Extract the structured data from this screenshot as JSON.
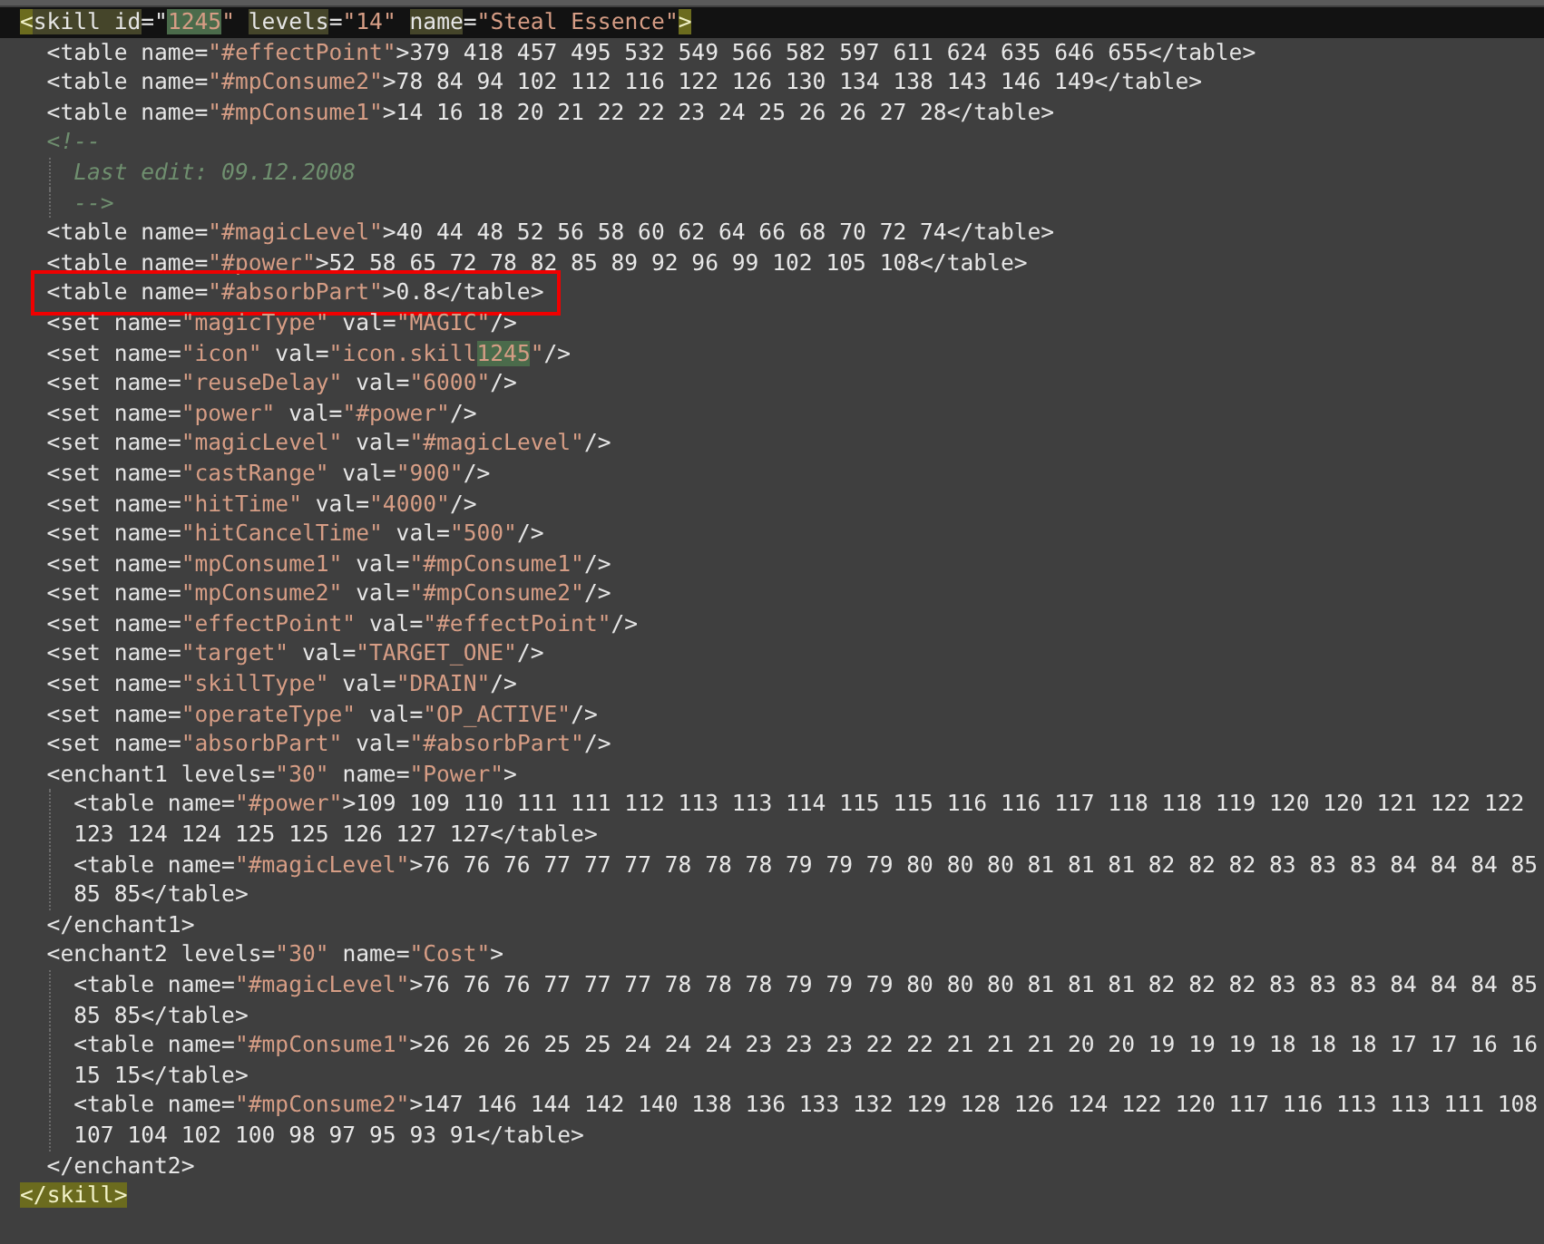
{
  "editor": {
    "lines": [
      {
        "current": true,
        "tokens": [
          {
            "text": "<",
            "kind": "bracket"
          },
          {
            "text": "skill",
            "kind": "word"
          },
          {
            "text": " id",
            "kind": "word"
          },
          {
            "text": "=\"",
            "kind": "attr"
          },
          {
            "text": "1245",
            "kind": "match"
          },
          {
            "text": "\" ",
            "kind": "value"
          },
          {
            "text": "levels",
            "kind": "word"
          },
          {
            "text": "=",
            "kind": "attr"
          },
          {
            "text": "\"14\" ",
            "kind": "value"
          },
          {
            "text": "name",
            "kind": "word"
          },
          {
            "text": "=",
            "kind": "attr"
          },
          {
            "text": "\"Steal Essence\"",
            "kind": "value"
          },
          {
            "text": ">",
            "kind": "bracket"
          }
        ],
        "children": [
          {
            "tokens": [
              {
                "text": "<table",
                "kind": "tag"
              },
              {
                "text": " name=",
                "kind": "attr"
              },
              {
                "text": "\"#effectPoint\"",
                "kind": "value"
              },
              {
                "text": ">",
                "kind": "tag"
              },
              {
                "text": "379 418 457 495 532 549 566 582 597 611 624 635 646 655",
                "kind": "text"
              },
              {
                "text": "</table>",
                "kind": "tag"
              }
            ]
          },
          {
            "tokens": [
              {
                "text": "<table",
                "kind": "tag"
              },
              {
                "text": " name=",
                "kind": "attr"
              },
              {
                "text": "\"#mpConsume2\"",
                "kind": "value"
              },
              {
                "text": ">",
                "kind": "tag"
              },
              {
                "text": "78 84 94 102 112 116 122 126 130 134 138 143 146 149",
                "kind": "text"
              },
              {
                "text": "</table>",
                "kind": "tag"
              }
            ]
          },
          {
            "tokens": [
              {
                "text": "<table",
                "kind": "tag"
              },
              {
                "text": " name=",
                "kind": "attr"
              },
              {
                "text": "\"#mpConsume1\"",
                "kind": "value"
              },
              {
                "text": ">",
                "kind": "tag"
              },
              {
                "text": "14 16 18 20 21 22 22 23 24 25 26 26 27 28",
                "kind": "text"
              },
              {
                "text": "</table>",
                "kind": "tag"
              }
            ]
          },
          {
            "guides": true,
            "tokens": [
              {
                "text": "<!--",
                "kind": "comment"
              }
            ],
            "children": [
              {
                "tokens": [
                  {
                    "text": "Last edit: 09.12.2008",
                    "kind": "comment"
                  }
                ]
              },
              {
                "tokens": [
                  {
                    "text": "-->",
                    "kind": "comment"
                  }
                ]
              }
            ]
          },
          {
            "tokens": [
              {
                "text": "<table",
                "kind": "tag"
              },
              {
                "text": " name=",
                "kind": "attr"
              },
              {
                "text": "\"#magicLevel\"",
                "kind": "value"
              },
              {
                "text": ">",
                "kind": "tag"
              },
              {
                "text": "40 44 48 52 56 58 60 62 64 66 68 70 72 74",
                "kind": "text"
              },
              {
                "text": "</table>",
                "kind": "tag"
              }
            ]
          },
          {
            "tokens": [
              {
                "text": "<table",
                "kind": "tag"
              },
              {
                "text": " name=",
                "kind": "attr"
              },
              {
                "text": "\"#power\"",
                "kind": "value"
              },
              {
                "text": ">",
                "kind": "tag"
              },
              {
                "text": "52 58 65 72 78 82 85 89 92 96 99 102 105 108",
                "kind": "text"
              },
              {
                "text": "</table>",
                "kind": "tag"
              }
            ]
          },
          {
            "boxed": true,
            "tokens": [
              {
                "text": "<table",
                "kind": "tag"
              },
              {
                "text": " name=",
                "kind": "attr"
              },
              {
                "text": "\"#absorbPart\"",
                "kind": "value"
              },
              {
                "text": ">",
                "kind": "tag"
              },
              {
                "text": "0.8",
                "kind": "text"
              },
              {
                "text": "</table>",
                "kind": "tag"
              }
            ]
          },
          {
            "tokens": [
              {
                "text": "<set",
                "kind": "tag"
              },
              {
                "text": " name=",
                "kind": "attr"
              },
              {
                "text": "\"magicType\"",
                "kind": "value"
              },
              {
                "text": " val=",
                "kind": "attr"
              },
              {
                "text": "\"MAGIC\"",
                "kind": "value"
              },
              {
                "text": "/>",
                "kind": "tag"
              }
            ]
          },
          {
            "tokens": [
              {
                "text": "<set",
                "kind": "tag"
              },
              {
                "text": " name=",
                "kind": "attr"
              },
              {
                "text": "\"icon\"",
                "kind": "value"
              },
              {
                "text": " val=",
                "kind": "attr"
              },
              {
                "text": "\"icon.skill",
                "kind": "value"
              },
              {
                "text": "1245",
                "kind": "match"
              },
              {
                "text": "\"",
                "kind": "value"
              },
              {
                "text": "/>",
                "kind": "tag"
              }
            ]
          },
          {
            "tokens": [
              {
                "text": "<set",
                "kind": "tag"
              },
              {
                "text": " name=",
                "kind": "attr"
              },
              {
                "text": "\"reuseDelay\"",
                "kind": "value"
              },
              {
                "text": " val=",
                "kind": "attr"
              },
              {
                "text": "\"6000\"",
                "kind": "value"
              },
              {
                "text": "/>",
                "kind": "tag"
              }
            ]
          },
          {
            "tokens": [
              {
                "text": "<set",
                "kind": "tag"
              },
              {
                "text": " name=",
                "kind": "attr"
              },
              {
                "text": "\"power\"",
                "kind": "value"
              },
              {
                "text": " val=",
                "kind": "attr"
              },
              {
                "text": "\"#power\"",
                "kind": "value"
              },
              {
                "text": "/>",
                "kind": "tag"
              }
            ]
          },
          {
            "tokens": [
              {
                "text": "<set",
                "kind": "tag"
              },
              {
                "text": " name=",
                "kind": "attr"
              },
              {
                "text": "\"magicLevel\"",
                "kind": "value"
              },
              {
                "text": " val=",
                "kind": "attr"
              },
              {
                "text": "\"#magicLevel\"",
                "kind": "value"
              },
              {
                "text": "/>",
                "kind": "tag"
              }
            ]
          },
          {
            "tokens": [
              {
                "text": "<set",
                "kind": "tag"
              },
              {
                "text": " name=",
                "kind": "attr"
              },
              {
                "text": "\"castRange\"",
                "kind": "value"
              },
              {
                "text": " val=",
                "kind": "attr"
              },
              {
                "text": "\"900\"",
                "kind": "value"
              },
              {
                "text": "/>",
                "kind": "tag"
              }
            ]
          },
          {
            "tokens": [
              {
                "text": "<set",
                "kind": "tag"
              },
              {
                "text": " name=",
                "kind": "attr"
              },
              {
                "text": "\"hitTime\"",
                "kind": "value"
              },
              {
                "text": " val=",
                "kind": "attr"
              },
              {
                "text": "\"4000\"",
                "kind": "value"
              },
              {
                "text": "/>",
                "kind": "tag"
              }
            ]
          },
          {
            "tokens": [
              {
                "text": "<set",
                "kind": "tag"
              },
              {
                "text": " name=",
                "kind": "attr"
              },
              {
                "text": "\"hitCancelTime\"",
                "kind": "value"
              },
              {
                "text": " val=",
                "kind": "attr"
              },
              {
                "text": "\"500\"",
                "kind": "value"
              },
              {
                "text": "/>",
                "kind": "tag"
              }
            ]
          },
          {
            "tokens": [
              {
                "text": "<set",
                "kind": "tag"
              },
              {
                "text": " name=",
                "kind": "attr"
              },
              {
                "text": "\"mpConsume1\"",
                "kind": "value"
              },
              {
                "text": " val=",
                "kind": "attr"
              },
              {
                "text": "\"#mpConsume1\"",
                "kind": "value"
              },
              {
                "text": "/>",
                "kind": "tag"
              }
            ]
          },
          {
            "tokens": [
              {
                "text": "<set",
                "kind": "tag"
              },
              {
                "text": " name=",
                "kind": "attr"
              },
              {
                "text": "\"mpConsume2\"",
                "kind": "value"
              },
              {
                "text": " val=",
                "kind": "attr"
              },
              {
                "text": "\"#mpConsume2\"",
                "kind": "value"
              },
              {
                "text": "/>",
                "kind": "tag"
              }
            ]
          },
          {
            "tokens": [
              {
                "text": "<set",
                "kind": "tag"
              },
              {
                "text": " name=",
                "kind": "attr"
              },
              {
                "text": "\"effectPoint\"",
                "kind": "value"
              },
              {
                "text": " val=",
                "kind": "attr"
              },
              {
                "text": "\"#effectPoint\"",
                "kind": "value"
              },
              {
                "text": "/>",
                "kind": "tag"
              }
            ]
          },
          {
            "tokens": [
              {
                "text": "<set",
                "kind": "tag"
              },
              {
                "text": " name=",
                "kind": "attr"
              },
              {
                "text": "\"target\"",
                "kind": "value"
              },
              {
                "text": " val=",
                "kind": "attr"
              },
              {
                "text": "\"TARGET_ONE\"",
                "kind": "value"
              },
              {
                "text": "/>",
                "kind": "tag"
              }
            ]
          },
          {
            "tokens": [
              {
                "text": "<set",
                "kind": "tag"
              },
              {
                "text": " name=",
                "kind": "attr"
              },
              {
                "text": "\"skillType\"",
                "kind": "value"
              },
              {
                "text": " val=",
                "kind": "attr"
              },
              {
                "text": "\"DRAIN\"",
                "kind": "value"
              },
              {
                "text": "/>",
                "kind": "tag"
              }
            ]
          },
          {
            "tokens": [
              {
                "text": "<set",
                "kind": "tag"
              },
              {
                "text": " name=",
                "kind": "attr"
              },
              {
                "text": "\"operateType\"",
                "kind": "value"
              },
              {
                "text": " val=",
                "kind": "attr"
              },
              {
                "text": "\"OP_ACTIVE\"",
                "kind": "value"
              },
              {
                "text": "/>",
                "kind": "tag"
              }
            ]
          },
          {
            "tokens": [
              {
                "text": "<set",
                "kind": "tag"
              },
              {
                "text": " name=",
                "kind": "attr"
              },
              {
                "text": "\"absorbPart\"",
                "kind": "value"
              },
              {
                "text": " val=",
                "kind": "attr"
              },
              {
                "text": "\"#absorbPart\"",
                "kind": "value"
              },
              {
                "text": "/>",
                "kind": "tag"
              }
            ]
          },
          {
            "guides": true,
            "tokens": [
              {
                "text": "<enchant1",
                "kind": "tag"
              },
              {
                "text": " levels=",
                "kind": "attr"
              },
              {
                "text": "\"30\"",
                "kind": "value"
              },
              {
                "text": " name=",
                "kind": "attr"
              },
              {
                "text": "\"Power\"",
                "kind": "value"
              },
              {
                "text": ">",
                "kind": "tag"
              }
            ],
            "children": [
              {
                "tokens": [
                  {
                    "text": "<table",
                    "kind": "tag"
                  },
                  {
                    "text": " name=",
                    "kind": "attr"
                  },
                  {
                    "text": "\"#power\"",
                    "kind": "value"
                  },
                  {
                    "text": ">",
                    "kind": "tag"
                  },
                  {
                    "text": "109 109 110 111 111 112 113 113 114 115 115 116 116 117 118 118 119 120 120 121 122 122 123 124 124 125 125 126 127 127",
                    "kind": "text"
                  },
                  {
                    "text": "</table>",
                    "kind": "tag"
                  }
                ]
              },
              {
                "tokens": [
                  {
                    "text": "<table",
                    "kind": "tag"
                  },
                  {
                    "text": " name=",
                    "kind": "attr"
                  },
                  {
                    "text": "\"#magicLevel\"",
                    "kind": "value"
                  },
                  {
                    "text": ">",
                    "kind": "tag"
                  },
                  {
                    "text": "76 76 76 77 77 77 78 78 78 79 79 79 80 80 80 81 81 81 82 82 82 83 83 83 84 84 84 85 85 85",
                    "kind": "text"
                  },
                  {
                    "text": "</table>",
                    "kind": "tag"
                  }
                ]
              }
            ]
          },
          {
            "tokens": [
              {
                "text": "</enchant1>",
                "kind": "tag"
              }
            ]
          },
          {
            "guides": true,
            "tokens": [
              {
                "text": "<enchant2",
                "kind": "tag"
              },
              {
                "text": " levels=",
                "kind": "attr"
              },
              {
                "text": "\"30\"",
                "kind": "value"
              },
              {
                "text": " name=",
                "kind": "attr"
              },
              {
                "text": "\"Cost\"",
                "kind": "value"
              },
              {
                "text": ">",
                "kind": "tag"
              }
            ],
            "children": [
              {
                "tokens": [
                  {
                    "text": "<table",
                    "kind": "tag"
                  },
                  {
                    "text": " name=",
                    "kind": "attr"
                  },
                  {
                    "text": "\"#magicLevel\"",
                    "kind": "value"
                  },
                  {
                    "text": ">",
                    "kind": "tag"
                  },
                  {
                    "text": "76 76 76 77 77 77 78 78 78 79 79 79 80 80 80 81 81 81 82 82 82 83 83 83 84 84 84 85 85 85",
                    "kind": "text"
                  },
                  {
                    "text": "</table>",
                    "kind": "tag"
                  }
                ]
              },
              {
                "tokens": [
                  {
                    "text": "<table",
                    "kind": "tag"
                  },
                  {
                    "text": " name=",
                    "kind": "attr"
                  },
                  {
                    "text": "\"#mpConsume1\"",
                    "kind": "value"
                  },
                  {
                    "text": ">",
                    "kind": "tag"
                  },
                  {
                    "text": "26 26 26 25 25 24 24 24 23 23 23 22 22 21 21 21 20 20 19 19 19 18 18 18 17 17 16 16 15 15",
                    "kind": "text"
                  },
                  {
                    "text": "</table>",
                    "kind": "tag"
                  }
                ]
              },
              {
                "tokens": [
                  {
                    "text": "<table",
                    "kind": "tag"
                  },
                  {
                    "text": " name=",
                    "kind": "attr"
                  },
                  {
                    "text": "\"#mpConsume2\"",
                    "kind": "value"
                  },
                  {
                    "text": ">",
                    "kind": "tag"
                  },
                  {
                    "text": "147 146 144 142 140 138 136 133 132 129 128 126 124 122 120 117 116 113 113 111 108 107 104 102 100 98 97 95 93 91",
                    "kind": "text"
                  },
                  {
                    "text": "</table>",
                    "kind": "tag"
                  }
                ]
              }
            ]
          },
          {
            "tokens": [
              {
                "text": "</enchant2>",
                "kind": "tag"
              }
            ]
          }
        ]
      },
      {
        "tokens": [
          {
            "text": "</",
            "kind": "bracket"
          },
          {
            "text": "skill",
            "kind": "bracket"
          },
          {
            "text": ">",
            "kind": "bracket"
          }
        ]
      }
    ]
  }
}
